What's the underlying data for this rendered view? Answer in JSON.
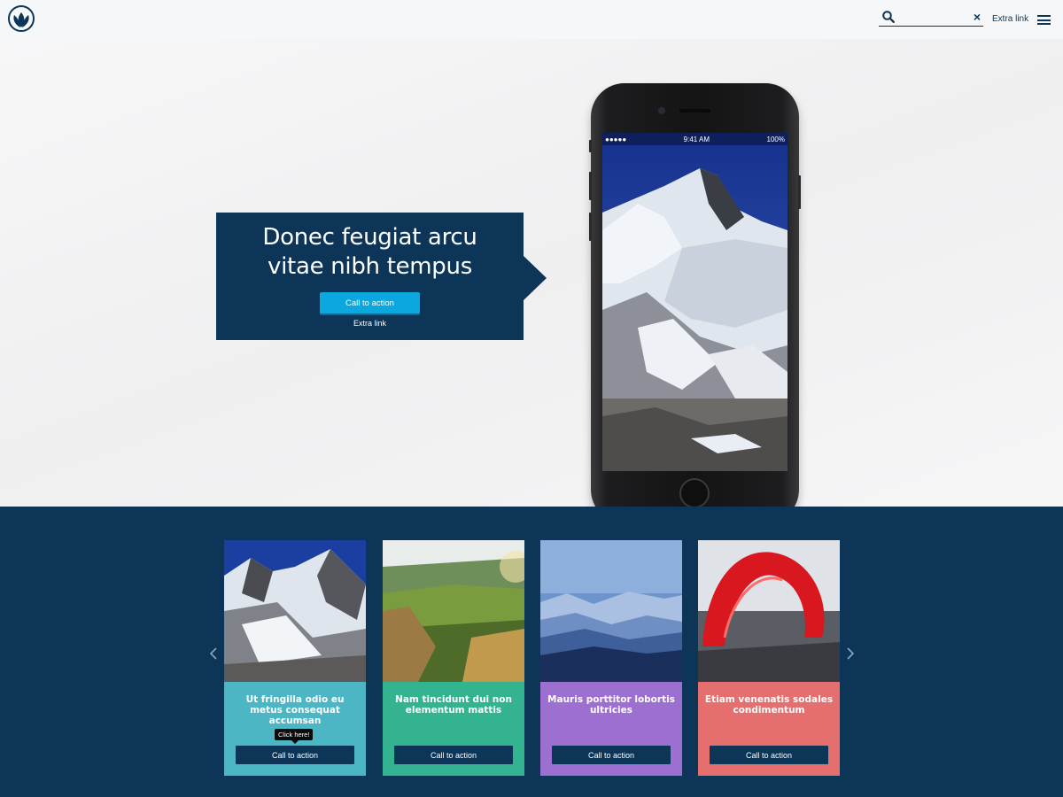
{
  "header": {
    "search": {
      "value": "",
      "placeholder": ""
    },
    "clear_symbol": "×",
    "extra_link": "Extra link"
  },
  "hero": {
    "headline_line1": "Donec feugiat arcu",
    "headline_line2": "vitae nibh tempus",
    "cta_label": "Call to action",
    "extra_link": "Extra link",
    "phone_time": "9:41 AM",
    "phone_carrier": "●●●●●",
    "phone_battery": "100%"
  },
  "carousel": {
    "cards": [
      {
        "title": "Ut fringilla odio eu metus consequat accumsan",
        "cta": "Call to action",
        "color": "#4cb6c5",
        "tooltip": "Click here!"
      },
      {
        "title": "Nam tincidunt dui non elementum mattis",
        "cta": "Call to action",
        "color": "#33b390"
      },
      {
        "title": "Mauris porttitor lobortis ultricies",
        "cta": "Call to action",
        "color": "#9c6fd1"
      },
      {
        "title": "Etiam venenatis sodales condimentum",
        "cta": "Call to action",
        "color": "#e56f6e"
      }
    ]
  },
  "icons": {
    "prev": "chevron-left-icon",
    "next": "chevron-right-icon",
    "search": "search-icon",
    "menu": "hamburger-menu-icon"
  }
}
